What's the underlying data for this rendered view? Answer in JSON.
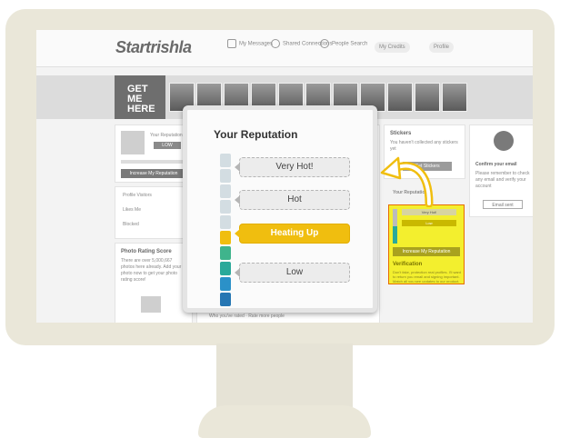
{
  "app": {
    "logo": "Startrishla",
    "nav": [
      "My Messages",
      "Shared Connections",
      "People Search"
    ],
    "my_credits": "My Credits",
    "profile": "Profile"
  },
  "strip": {
    "get_me_here": "GET ME HERE"
  },
  "left_panel": {
    "user_status": "Your Reputation",
    "badge": "LOW",
    "increase_button": "Increase My Reputation",
    "links": [
      "Profile Visitors",
      "Likes Me",
      "Blocked"
    ],
    "photo_rating_title": "Photo Rating Score",
    "photo_rating_text": "There are over 5,000,667 photos here already. Add your photo now to get your photo rating score!"
  },
  "center": {
    "footer_text": "Who you've rated · Rate more people"
  },
  "right_panel": {
    "stickers_title": "Stickers",
    "stickers_text": "You haven't collected any stickers yet",
    "stickers_button": "Get Stickers",
    "reputation_title": "Your Reputation",
    "mini_levels": [
      "Very Hot!",
      "Low"
    ],
    "mini_button": "Increase My Reputation",
    "verification_title": "Verification",
    "verification_text": "Don't fake, protection real profiles. I'll want to return you email and signing important. Match all you see updates to our product.",
    "confirm_title": "Confirm your email",
    "confirm_text": "Please remember to check any email and verify your account",
    "confirm_button": "Email sent"
  },
  "popup": {
    "title": "Your Reputation",
    "levels": [
      "Very Hot!",
      "Hot",
      "Heating Up",
      "Low"
    ],
    "active_level": "Heating Up",
    "meter_colors": [
      "#d3dde2",
      "#d3dde2",
      "#d3dde2",
      "#d3dde2",
      "#d3dde2",
      "#f0be0f",
      "#3fb48c",
      "#2aa99a",
      "#2b91c8",
      "#2576b3"
    ]
  }
}
